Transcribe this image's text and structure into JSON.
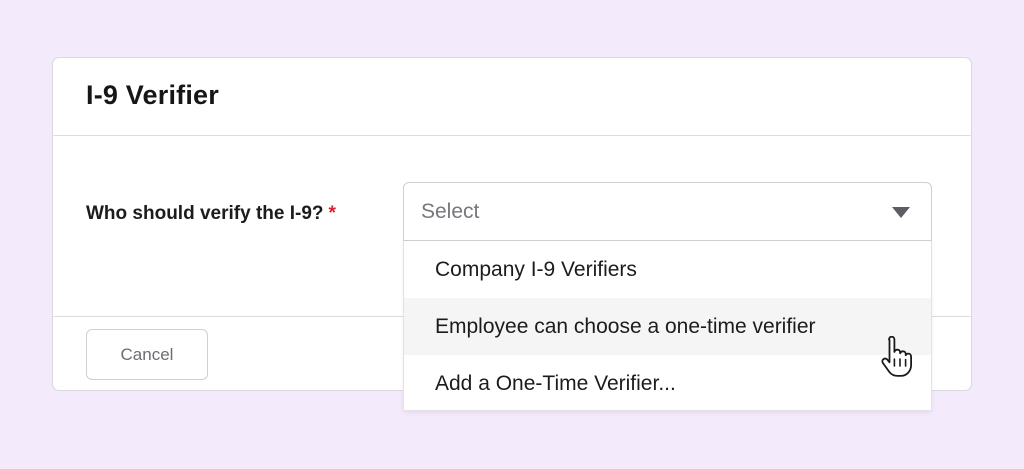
{
  "card": {
    "title": "I-9 Verifier"
  },
  "field": {
    "label": "Who should verify the I-9?",
    "required_mark": "*"
  },
  "select": {
    "placeholder": "Select",
    "options": [
      "Company I-9 Verifiers",
      "Employee can choose a one-time verifier",
      "Add a One-Time Verifier..."
    ],
    "hovered_index": 1
  },
  "footer": {
    "cancel_label": "Cancel"
  },
  "colors": {
    "page_background": "#f3eafc",
    "required": "#d8222c",
    "hover_background": "#f5f5f6"
  },
  "icons": {
    "caret": "caret-down-icon",
    "cursor": "hand-pointer-icon"
  }
}
